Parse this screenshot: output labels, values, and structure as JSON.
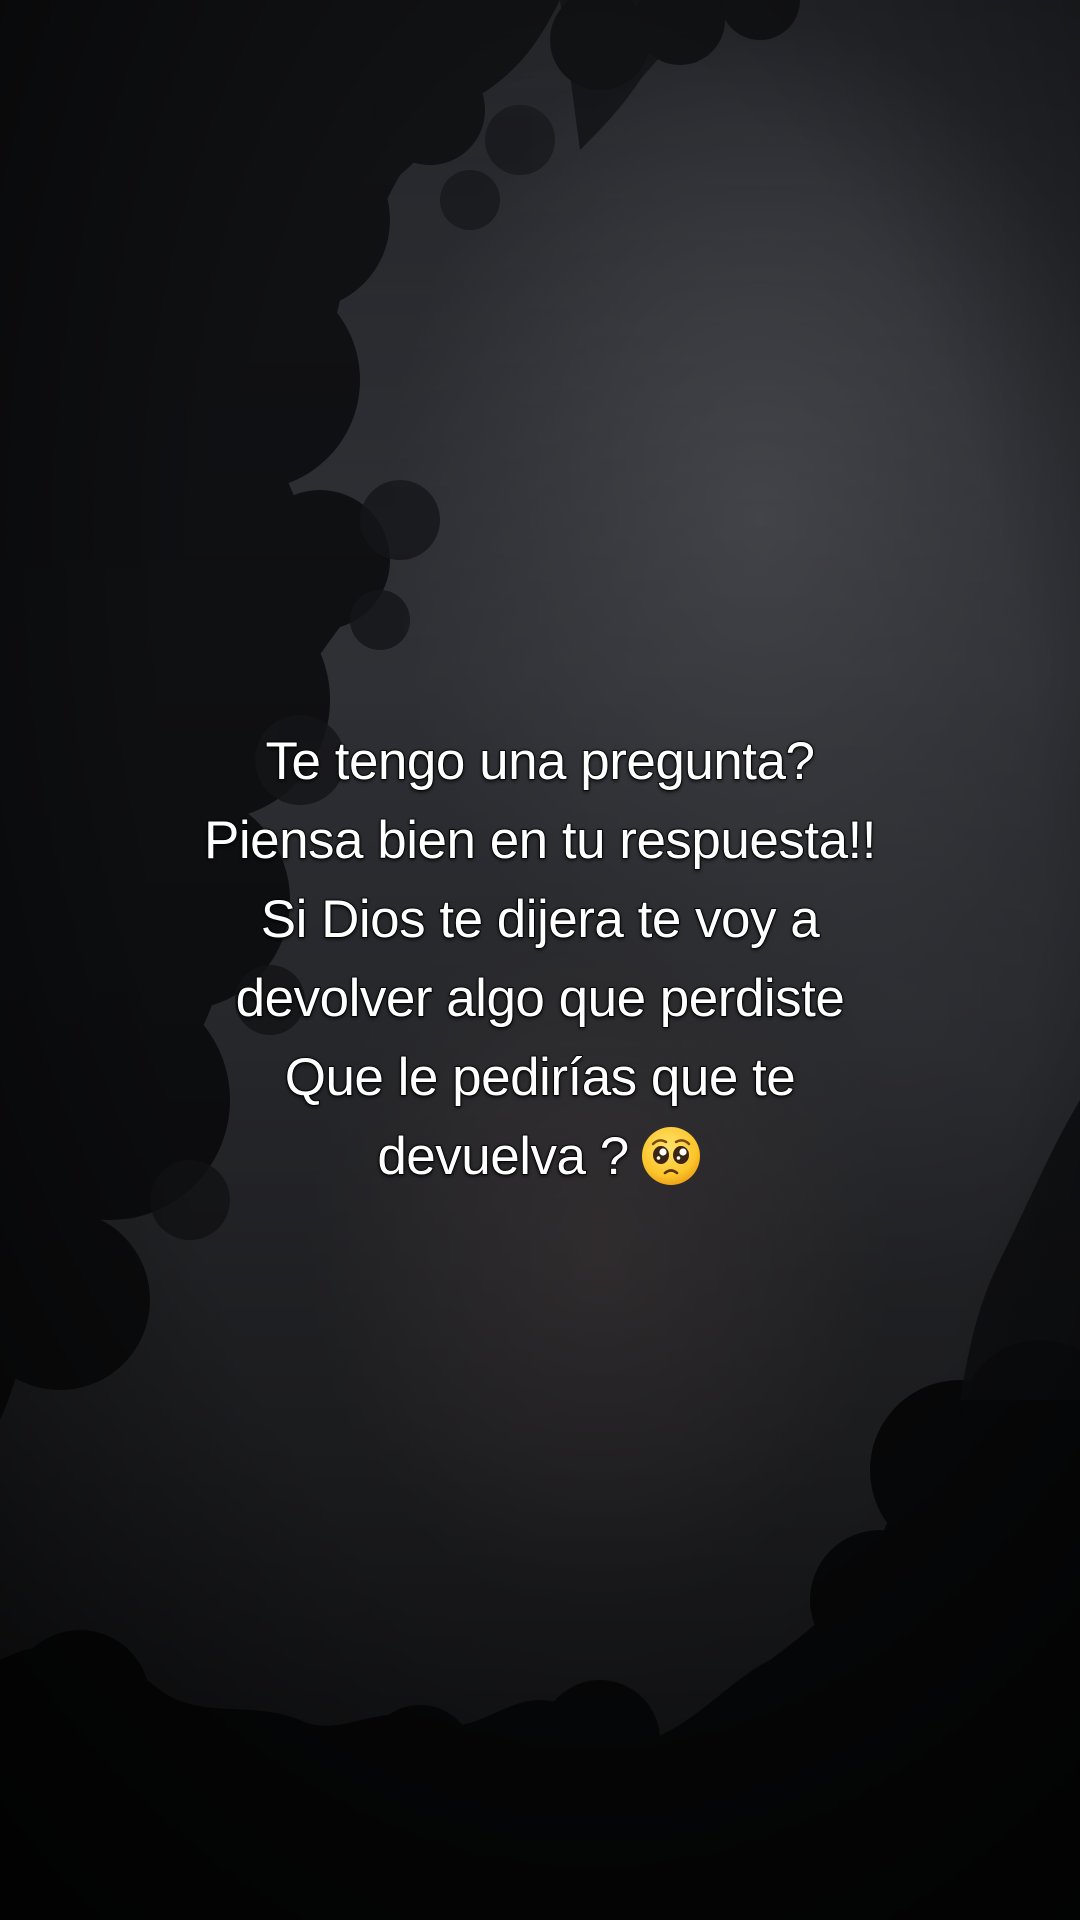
{
  "caption": {
    "lines": [
      "Te tengo una pregunta?",
      "Piensa bien en tu respuesta!!",
      "Si Dios te dijera te voy a",
      "devolver algo que perdiste",
      "Que le pedirías que te",
      "devuelva ?"
    ],
    "emoji_icon": "pleading-face-emoji"
  },
  "background": {
    "description_colors": {
      "sky": "#3a3c42",
      "trees": "#0d0e10",
      "warm_glow": "#60565a"
    }
  }
}
